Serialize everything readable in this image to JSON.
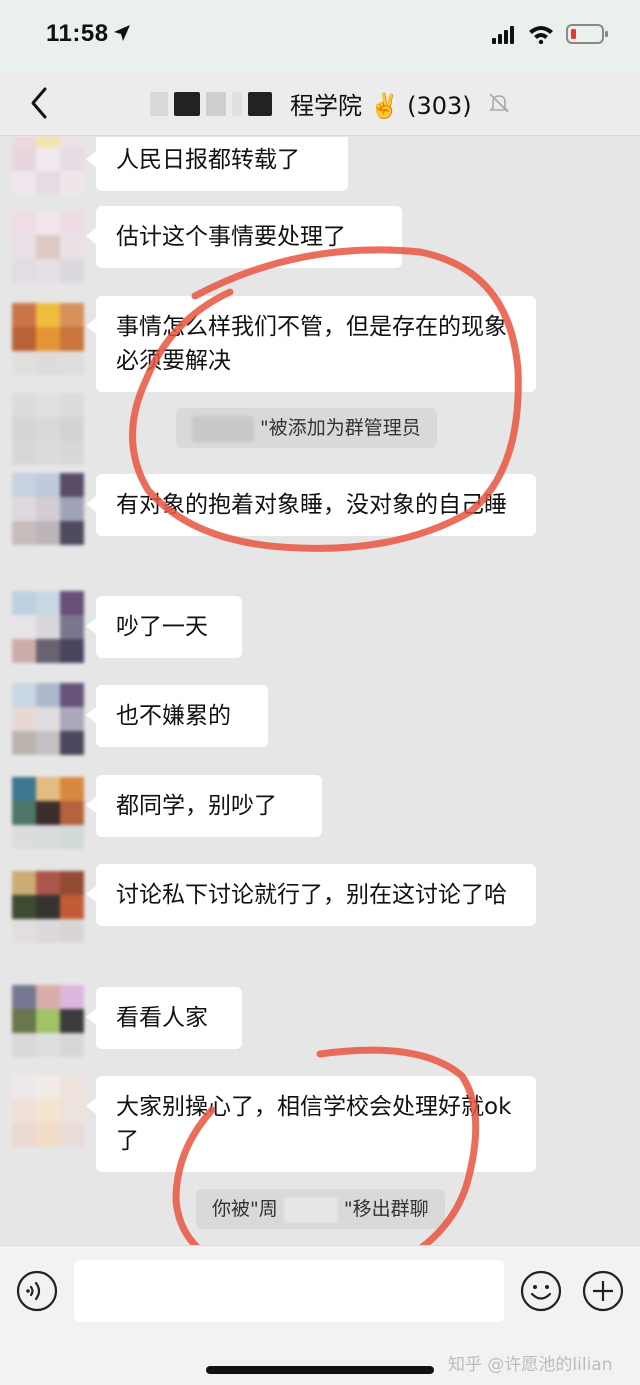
{
  "status_bar": {
    "time": "11:58"
  },
  "nav": {
    "title": "程学院 ✌️ (303)"
  },
  "messages": [
    {
      "text": "人民日报都转载了"
    },
    {
      "text": "估计这个事情要处理了"
    },
    {
      "text": "事情怎么样我们不管，但是存在的现象必须要解决"
    },
    {
      "text": "有对象的抱着对象睡，没对象的自己睡"
    },
    {
      "text": "吵了一天"
    },
    {
      "text": "也不嫌累的"
    },
    {
      "text": "都同学，别吵了"
    },
    {
      "text": "讨论私下讨论就行了，别在这讨论了哈"
    },
    {
      "text": "看看人家"
    },
    {
      "text": "大家别操心了，相信学校会处理好就ok了"
    }
  ],
  "system_notices": [
    {
      "prefix": "",
      "suffix": "\"被添加为群管理员"
    },
    {
      "prefix": "你被\"周",
      "suffix": "\"移出群聊"
    }
  ],
  "watermark": "知乎 @许愿池的lilian",
  "colors": {
    "scribble": "#e8553f",
    "bubble": "#ffffff",
    "background": "#e6e6e6"
  }
}
